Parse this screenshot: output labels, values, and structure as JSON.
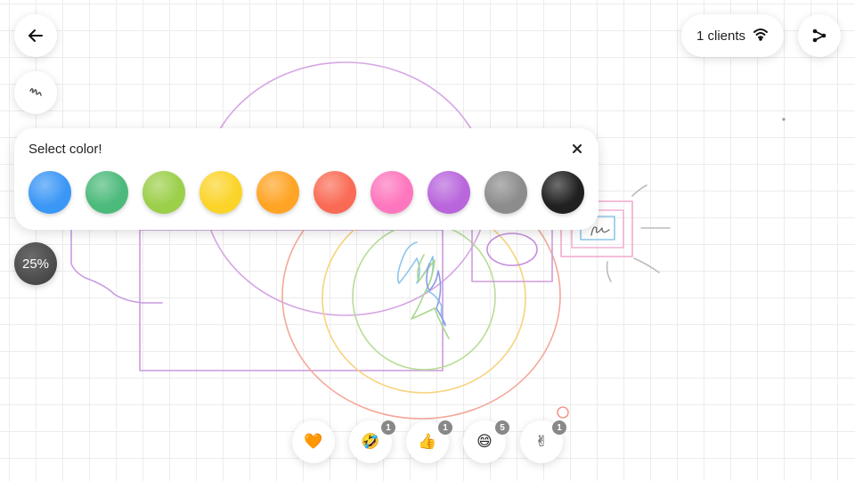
{
  "toolbar": {
    "back_icon": "arrow-left-icon",
    "pen_icon": "scribble-pen-icon",
    "zoom_label": "25%"
  },
  "connection": {
    "clients_label": "1 clients",
    "icon": "wifi-icon",
    "share_icon": "share-icon"
  },
  "color_picker": {
    "title": "Select color!",
    "close_icon": "close-icon",
    "colors": [
      {
        "name": "blue",
        "hex": "#3b97f6"
      },
      {
        "name": "green",
        "hex": "#4cba7b"
      },
      {
        "name": "lime",
        "hex": "#9ccf4a"
      },
      {
        "name": "yellow",
        "hex": "#fbd42a"
      },
      {
        "name": "orange",
        "hex": "#ffa424"
      },
      {
        "name": "red",
        "hex": "#fa6b55"
      },
      {
        "name": "pink",
        "hex": "#fe76bd"
      },
      {
        "name": "purple",
        "hex": "#b966dc"
      },
      {
        "name": "gray",
        "hex": "#8c8c8c"
      },
      {
        "name": "black",
        "hex": "#202020"
      }
    ]
  },
  "reactions": [
    {
      "icon": "heart-icon",
      "glyph": "🧡",
      "count": ""
    },
    {
      "icon": "rolling-laughing-icon",
      "glyph": "🤣",
      "count": "1"
    },
    {
      "icon": "thumbs-up-icon",
      "glyph": "👍",
      "count": "1"
    },
    {
      "icon": "grinning-icon",
      "glyph": "😄",
      "count": "5"
    },
    {
      "icon": "victory-hand-icon",
      "glyph": "✌",
      "count": "1"
    }
  ]
}
